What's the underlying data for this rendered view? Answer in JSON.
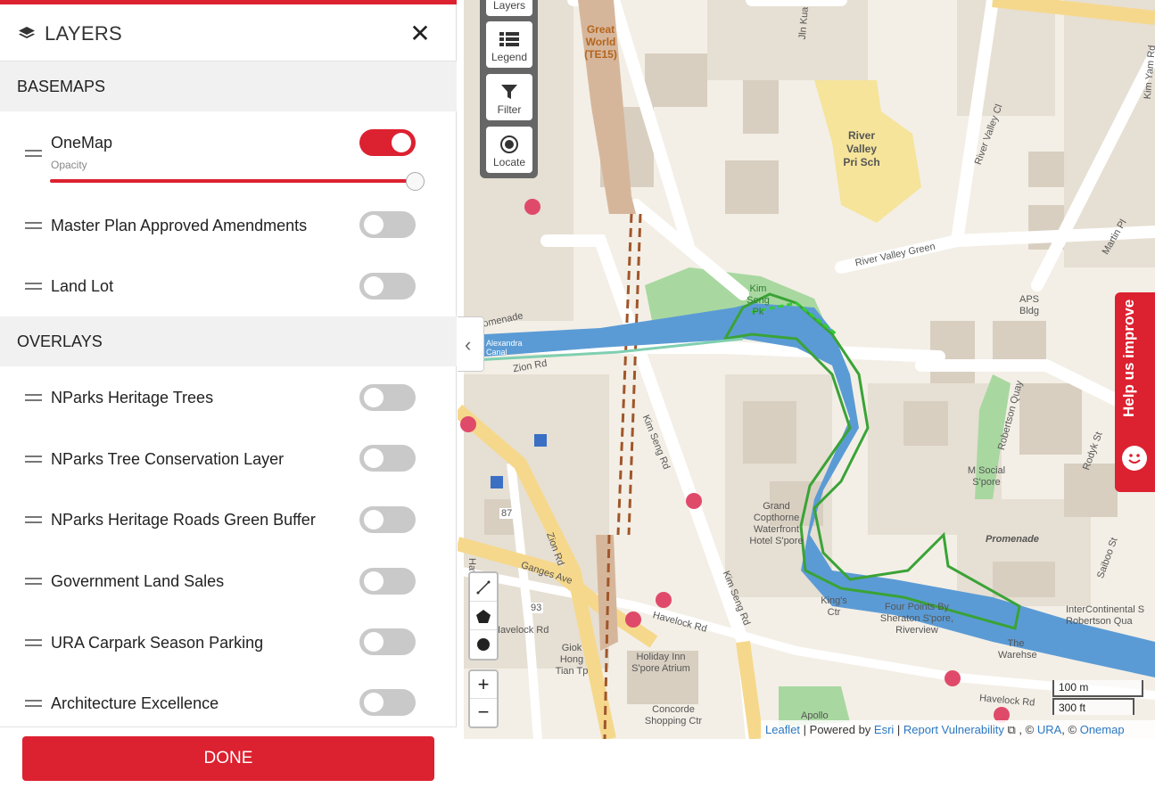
{
  "panel": {
    "title": "LAYERS",
    "close_symbol": "✕",
    "basemaps_header": "BASEMAPS",
    "overlays_header": "OVERLAYS",
    "opacity_label": "Opacity",
    "basemaps": [
      {
        "label": "OneMap",
        "on": true,
        "opacity": 1.0
      },
      {
        "label": "Master Plan Approved Amendments",
        "on": false
      },
      {
        "label": "Land Lot",
        "on": false
      }
    ],
    "overlays": [
      {
        "label": "NParks Heritage Trees",
        "on": false
      },
      {
        "label": "NParks Tree Conservation Layer",
        "on": false
      },
      {
        "label": "NParks Heritage Roads Green Buffer",
        "on": false
      },
      {
        "label": "Government Land Sales",
        "on": false
      },
      {
        "label": "URA Carpark Season Parking",
        "on": false
      },
      {
        "label": "Architecture Excellence",
        "on": false
      }
    ],
    "done_label": "DONE"
  },
  "map_tools": {
    "layers": "Layers",
    "legend": "Legend",
    "filter": "Filter",
    "locate": "Locate"
  },
  "map_labels": {
    "great_world": "Great World (TE15)",
    "river_valley_pri": "River Valley Pri Sch",
    "river_valley_green": "River Valley Green",
    "river_valley_cl": "River Valley Cl",
    "martin_pl": "Martin Pl",
    "jln_kuala": "Jln Kua",
    "kim_yam_rd": "Kim Yam Rd",
    "aps_bldg": "APS Bldg",
    "kim_seng_pk": "Kim Seng Pk",
    "promenade_left": "omenade",
    "alexandra_canal": "Alexandra Canal",
    "zion_rd": "Zion Rd",
    "kim_seng_rd_1": "Kim Seng Rd",
    "kim_seng_rd_2": "Kim Seng Rd",
    "robertson_quay": "Robertson Quay",
    "rodyk_st": "Rodyk St",
    "m_social": "M Social S'pore",
    "promenade_right": "Promenade",
    "saiboo_st": "Saiboo St",
    "grand_copthorne": "Grand Copthorne Waterfront Hotel S'pore",
    "kings_ctr": "King's Ctr",
    "four_points": "Four Points By Sheraton S'pore, Riverview",
    "intercontinental": "InterContinental S Robertson Qua",
    "the_warehouse": "The Warehse",
    "zion_rd_v": "Zion Rd",
    "ganges_ave": "Ganges Ave",
    "havelock_rd_1": "Havelock Rd",
    "havelock_rd_2": "Havelock Rd",
    "havelock_rd_3": "Havelock Rd",
    "giok_hong": "Giok Hong Tian Tp",
    "holiday_inn": "Holiday Inn S'pore Atrium",
    "concorde": "Concorde Shopping Ctr",
    "apollo": "Apollo",
    "havelock_lk": "Havelock Lk",
    "num_87": "87",
    "num_93": "93"
  },
  "scale": {
    "metric": "100 m",
    "imperial": "300 ft"
  },
  "attribution": {
    "leaflet": "Leaflet",
    "powered": " | Powered by ",
    "esri": "Esri",
    "sep": " | ",
    "report": "Report Vulnerability",
    "copy1": " , © ",
    "ura": "URA",
    "copy2": ", © ",
    "onemap": "Onemap"
  },
  "help": {
    "label": "Help us improve"
  },
  "colors": {
    "accent": "#dc2130",
    "water": "#5b9bd5",
    "park": "#a8d8a0",
    "school": "#f5e49a"
  }
}
